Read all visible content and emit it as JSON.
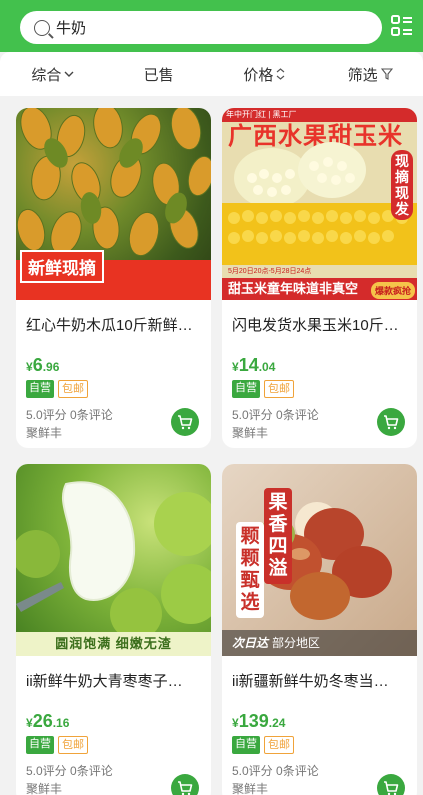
{
  "search": {
    "query": "牛奶"
  },
  "filters": [
    {
      "label": "综合",
      "icon": "chevron-down-icon"
    },
    {
      "label": "已售",
      "icon": ""
    },
    {
      "label": "价格",
      "icon": "sort-updown-icon"
    },
    {
      "label": "筛选",
      "icon": "filter-icon"
    }
  ],
  "products": [
    {
      "title": "红心牛奶木瓜10斤新鲜…",
      "price_int": "6",
      "price_dec": ".96",
      "tag1": "自营",
      "tag2": "包邮",
      "rating": "5.0评分 0条评论",
      "shop": "聚鲜丰",
      "banner": "新鲜现摘"
    },
    {
      "title": "闪电发货水果玉米10斤…",
      "price_int": "14",
      "price_dec": ".04",
      "tag1": "自营",
      "tag2": "包邮",
      "rating": "5.0评分 0条评论",
      "shop": "聚鲜丰",
      "banner": "甜玉米童年味道非真空",
      "headline": "广西水果甜玉米",
      "side": "现摘现发",
      "badge": "爆款疯抢",
      "date": "5月20日20点-5月28日24点",
      "top": "年中开门红 | 黑工厂"
    },
    {
      "title": "ii新鲜牛奶大青枣枣子…",
      "price_int": "26",
      "price_dec": ".16",
      "tag1": "自营",
      "tag2": "包邮",
      "rating": "5.0评分 0条评论",
      "shop": "聚鲜丰",
      "banner": "圆润饱满 细嫩无渣"
    },
    {
      "title": "ii新疆新鲜牛奶冬枣当…",
      "price_int": "139",
      "price_dec": ".24",
      "tag1": "自营",
      "tag2": "包邮",
      "rating": "5.0评分 0条评论",
      "shop": "聚鲜丰",
      "v1": "果香四溢",
      "v2": "颗颗甄选",
      "ship": "部分地区",
      "ship_brand": "次日达"
    }
  ],
  "currency": "¥",
  "colors": {
    "accent": "#43c14d",
    "price": "#3aa83f",
    "tag_orange": "#f0a33a"
  }
}
